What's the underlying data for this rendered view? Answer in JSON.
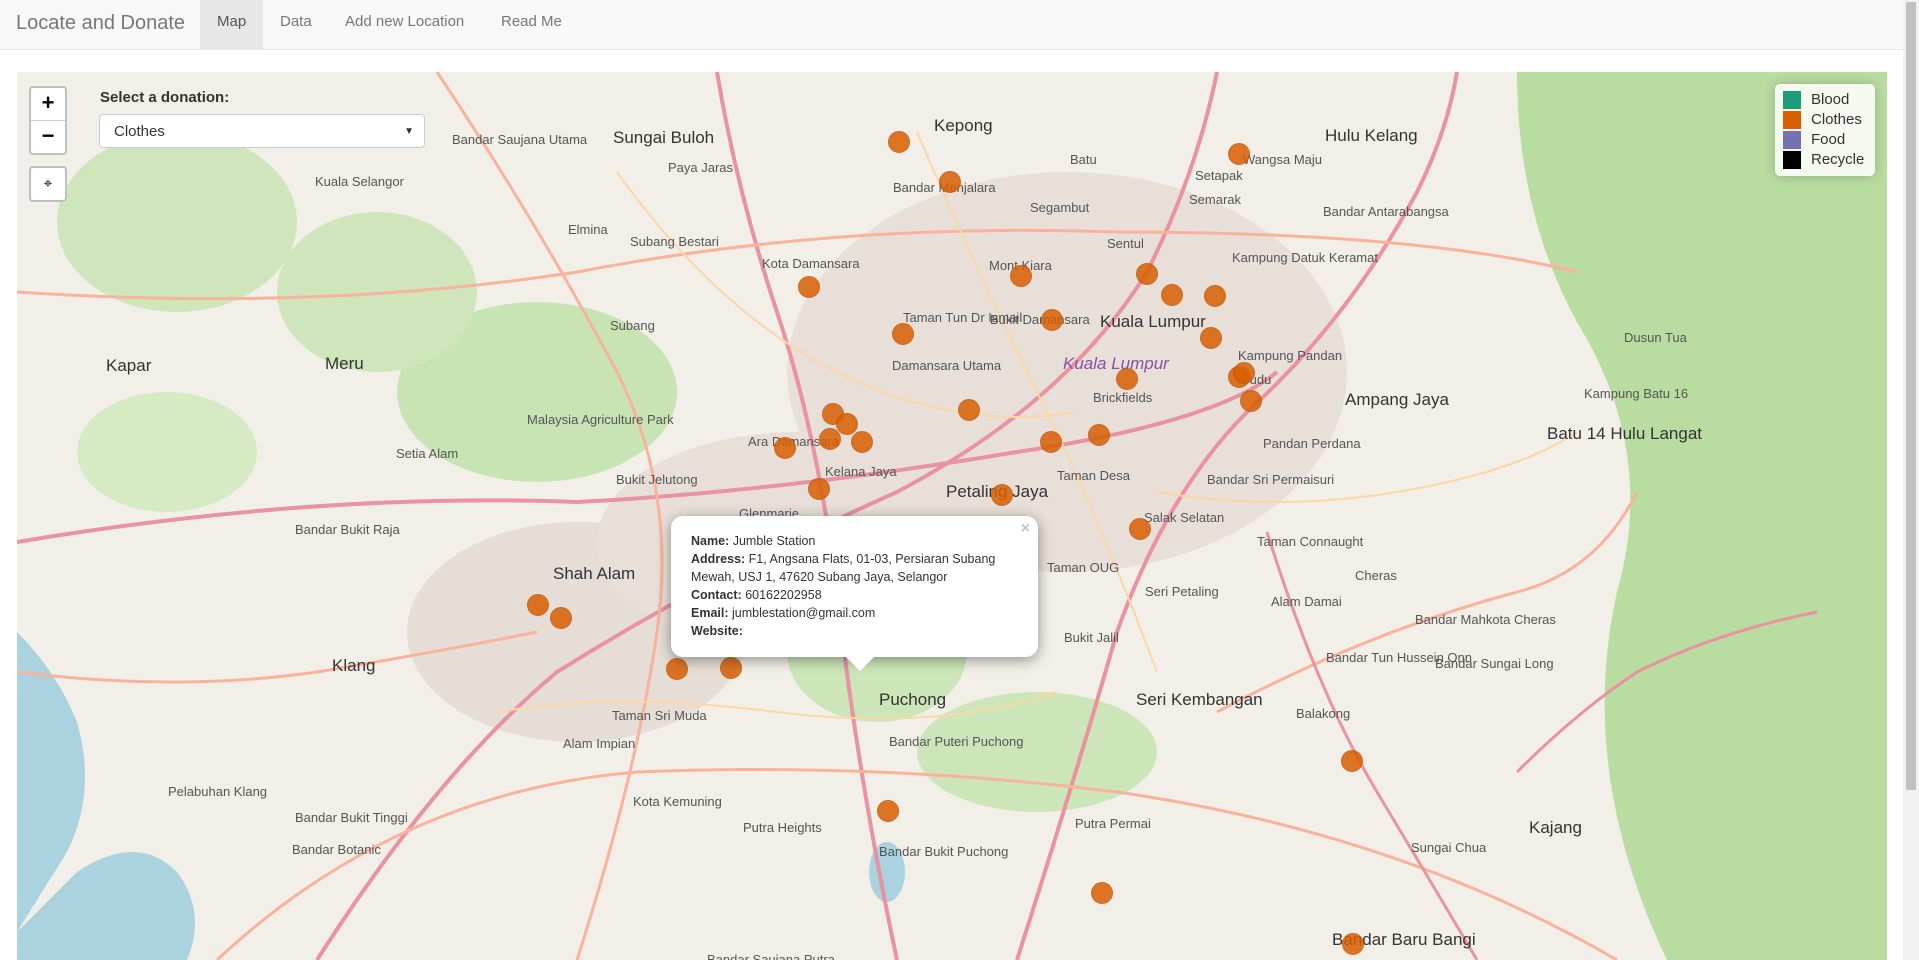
{
  "app": {
    "title": "Locate and Donate"
  },
  "nav": {
    "items": [
      {
        "label": "Map",
        "active": true
      },
      {
        "label": "Data"
      },
      {
        "label": "Add new Location"
      },
      {
        "label": "Read Me"
      }
    ]
  },
  "map_controls": {
    "zoom_in": "+",
    "zoom_out": "−",
    "locate_icon": "crosshair-icon"
  },
  "donation": {
    "label": "Select a donation:",
    "selected": "Clothes"
  },
  "legend": {
    "items": [
      {
        "label": "Blood",
        "color": "#1b9e77"
      },
      {
        "label": "Clothes",
        "color": "#d95f02"
      },
      {
        "label": "Food",
        "color": "#7570b3"
      },
      {
        "label": "Recycle",
        "color": "#000000"
      }
    ]
  },
  "popup": {
    "name_label": "Name:",
    "name": "Jumble Station",
    "address_label": "Address:",
    "address": "F1, Angsana Flats, 01-03, Persiaran Subang Mewah, USJ 1, 47620 Subang Jaya, Selangor",
    "contact_label": "Contact:",
    "contact": "60162202958",
    "email_label": "Email:",
    "email": "jumblestation@gmail.com",
    "website_label": "Website:",
    "website": "",
    "close": "×"
  },
  "places": [
    "Kepong",
    "Sungai Buloh",
    "Bandar Menjalara",
    "Segambut",
    "Sentul",
    "Setapak",
    "Wangsa Maju",
    "Hulu Kelang",
    "Kuala Lumpur",
    "Kota Damansara",
    "Subang Bestari",
    "Subang",
    "Meru",
    "Kapar",
    "Elmina",
    "Bandar Saujana Utama",
    "Kuala Selangor",
    "Paya Jaras",
    "Mont Kiara",
    "Bukit Damansara",
    "Taman Tun Dr Ismail",
    "Damansara Utama",
    "Ampang Jaya",
    "Kampung Pandan",
    "Pudu",
    "Brickfields",
    "Petaling Jaya",
    "Kelana Jaya",
    "Ara Damansara",
    "Bukit Jelutong",
    "Setia Alam",
    "Shah Alam",
    "Klang",
    "Pelabuhan Klang",
    "Puchong",
    "Bandar Puteri Puchong",
    "Seri Kembangan",
    "Kajang",
    "Bandar Baru Bangi",
    "Cheras",
    "Balakong",
    "Alam Damai",
    "Taman OUG",
    "Salak Selatan",
    "Pandan Perdana",
    "Batu 14 Hulu Langat",
    "Bandar Tun Hussein Onn",
    "Bandar Mahkota Cheras",
    "Bandar Sungai Long",
    "Sungai Chua",
    "Putra Heights",
    "Bandar Bukit Puchong",
    "Putra Permai",
    "Kota Kemuning",
    "Taman Sri Muda",
    "Alam Impian",
    "Bandar Bukit Tinggi",
    "Bandar Botanic",
    "Bandar Bukit Raja",
    "Dusun Tua",
    "Kampung Batu 16",
    "Bandar Antarabangsa",
    "Kampung Datuk Keramat",
    "Malaysia Agriculture Park",
    "Glenmarie",
    "Semarak",
    "Bukit Jalil",
    "Seri Petaling",
    "Taman Desa",
    "Taman Connaught",
    "Bandar Sri Permaisuri",
    "Kuala Lumpur",
    "Bandar Saujana Putra",
    "Batu"
  ],
  "marker_color": "#d95f02"
}
